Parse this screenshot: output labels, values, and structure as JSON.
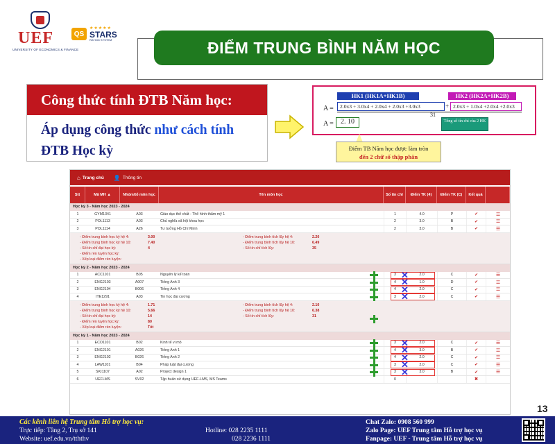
{
  "header": {
    "logo_text": "UEF",
    "logo_subtitle": "UNIVERSITY OF ECONOMICS & FINANCE",
    "qs_badge": "QS",
    "qs_stars_label": "STARS",
    "qs_subtitle": "RATING SYSTEM",
    "title": "ĐIỂM TRUNG BÌNH NĂM HỌC"
  },
  "formula_box": {
    "heading": "Công thức tính ĐTB Năm học:",
    "body_part1": "Áp dụng công thức ",
    "body_part2": "như cách tính",
    "body_part3": "ĐTB Học kỳ"
  },
  "formula_image": {
    "hk1_label": "HK1 (HK1A+HK1B)",
    "hk2_label": "HK2 (HK2A+HK2B)",
    "a_equals": "A =",
    "numerator_hk1": "2.0x3 + 3.0x4 + 2.0x4 + 2.0x3 +3.0x3",
    "plus": "+",
    "numerator_hk2": "2.0x3 + 1.0x4 +2.0x4 +2.0x3",
    "denominator": "31",
    "a_result_prefix": "A =",
    "result": "2. 10",
    "credits_note": "Tổng số tín chỉ của 2 HK",
    "rounding_note": "Điểm TB Năm học được làm tròn",
    "rounding_note_red": "đến 2 chữ số thập phân"
  },
  "screenshot": {
    "nav_tabs": [
      {
        "label": "Trang chủ",
        "icon": "home-icon"
      },
      {
        "label": "Thông tin",
        "icon": "user-icon"
      }
    ],
    "columns": [
      "Stt",
      "Mã MH ▲",
      "Nhóm/tổ môn học",
      "Tên môn học",
      "Số tín chỉ",
      "Điểm TK (4)",
      "Điểm TK (C)",
      "Kết quả",
      ""
    ],
    "sections": [
      {
        "title": "Học kỳ 3 - Năm học 2023 - 2024",
        "rows": [
          {
            "stt": "1",
            "code": "GYM1341",
            "group": "A03",
            "name": "Giáo dục thể chất - Thể hình thẩm mỹ 1",
            "credits": "1",
            "gpa4": "4.0",
            "grade": "P",
            "result": "✔",
            "more": "☰"
          },
          {
            "stt": "2",
            "code": "POL1113",
            "group": "A03",
            "name": "Chủ nghĩa xã hội khoa học",
            "credits": "2",
            "gpa4": "3.0",
            "grade": "B",
            "result": "✔",
            "more": "☰"
          },
          {
            "stt": "3",
            "code": "POL1114",
            "group": "A26",
            "name": "Tư tưởng Hồ Chí Minh",
            "credits": "2",
            "gpa4": "3.0",
            "grade": "B",
            "result": "✔",
            "more": "☰"
          }
        ],
        "summary": {
          "left": [
            {
              "label": "- Điểm trung bình học kỳ hệ 4:",
              "value": "3.00"
            },
            {
              "label": "- Điểm trung bình học kỳ hệ 10:",
              "value": "7.40"
            },
            {
              "label": "- Số tín chỉ đạt học kỳ:",
              "value": "4"
            },
            {
              "label": "- Điểm rèn luyện học kỳ:",
              "value": ""
            },
            {
              "label": "- Xếp loại điểm rèn luyện:",
              "value": ""
            }
          ],
          "right": [
            {
              "label": "- Điểm trung bình tích lũy hệ 4:",
              "value": "2.20"
            },
            {
              "label": "- Điểm trung bình tích lũy hệ 10:",
              "value": "6.49"
            },
            {
              "label": "- Số tín chỉ tích lũy:",
              "value": "35"
            }
          ]
        }
      },
      {
        "title": "Học kỳ 2 - Năm học 2023 - 2024",
        "rows": [
          {
            "stt": "1",
            "code": "ACC1101",
            "group": "B05",
            "name": "Nguyên lý kế toán",
            "credits": "3",
            "gpa4": "2.0",
            "grade": "C",
            "result": "✔",
            "more": "☰"
          },
          {
            "stt": "2",
            "code": "ENG2103",
            "group": "A007",
            "name": "Tiếng Anh 3",
            "credits": "4",
            "gpa4": "1.0",
            "grade": "D",
            "result": "✔",
            "more": "☰"
          },
          {
            "stt": "3",
            "code": "ENG2104",
            "group": "B006",
            "name": "Tiếng Anh 4",
            "credits": "4",
            "gpa4": "2.0",
            "grade": "C",
            "result": "✔",
            "more": "☰"
          },
          {
            "stt": "4",
            "code": "ITE1291",
            "group": "A03",
            "name": "Tin học đại cương",
            "credits": "3",
            "gpa4": "2.0",
            "grade": "C",
            "result": "✔",
            "more": "☰"
          }
        ],
        "summary": {
          "left": [
            {
              "label": "- Điểm trung bình học kỳ hệ 4:",
              "value": "1.71"
            },
            {
              "label": "- Điểm trung bình học kỳ hệ 10:",
              "value": "5.66"
            },
            {
              "label": "- Số tín chỉ đạt học kỳ:",
              "value": "14"
            },
            {
              "label": "- Điểm rèn luyện học kỳ:",
              "value": "80"
            },
            {
              "label": "- Xếp loại điểm rèn luyện:",
              "value": "Tốt"
            }
          ],
          "right": [
            {
              "label": "- Điểm trung bình tích lũy hệ 4:",
              "value": "2.10"
            },
            {
              "label": "- Điểm trung bình tích lũy hệ 10:",
              "value": "6.38"
            },
            {
              "label": "- Số tín chỉ tích lũy:",
              "value": "31"
            }
          ]
        }
      },
      {
        "title": "Học kỳ 1 - Năm học 2023 - 2024",
        "rows": [
          {
            "stt": "1",
            "code": "ECO1101",
            "group": "B02",
            "name": "Kinh tế vi mô",
            "credits": "3",
            "gpa4": "2.0",
            "grade": "C",
            "result": "✔",
            "more": "☰"
          },
          {
            "stt": "2",
            "code": "ENG2101",
            "group": "A026",
            "name": "Tiếng Anh 1",
            "credits": "4",
            "gpa4": "3.0",
            "grade": "B",
            "result": "✔",
            "more": "☰"
          },
          {
            "stt": "3",
            "code": "ENG2102",
            "group": "B026",
            "name": "Tiếng Anh 2",
            "credits": "4",
            "gpa4": "2.0",
            "grade": "C",
            "result": "✔",
            "more": "☰"
          },
          {
            "stt": "4",
            "code": "LAW1101",
            "group": "B04",
            "name": "Pháp luật đại cương",
            "credits": "3",
            "gpa4": "2.0",
            "grade": "C",
            "result": "✔",
            "more": "☰"
          },
          {
            "stt": "5",
            "code": "SKI1107",
            "group": "A02",
            "name": "Project design 1",
            "credits": "3",
            "gpa4": "3.0",
            "grade": "B",
            "result": "✔",
            "more": "☰"
          },
          {
            "stt": "6",
            "code": "UEFLMS",
            "group": "SV02",
            "name": "Tập huấn sử dụng UEF-LMS, MS Teams",
            "credits": "0",
            "gpa4": "",
            "grade": "",
            "result": "✖",
            "more": ""
          }
        ]
      }
    ]
  },
  "footer": {
    "heading": "Các kênh liên hệ Trung tâm Hỗ trợ học vụ:",
    "direct": "Trực tiếp: Tầng 2, Trụ sở 141",
    "website": "Website:   uef.edu.vn/tththv",
    "hotline1": "Hotline: 028 2235 1111",
    "hotline2": "028 2236 1111",
    "chat": "Chat Zalo: 0908 560 999",
    "zalo": "Zalo Page:  UEF Trung tâm Hỗ trợ học vụ",
    "fanpage": "Fanpage:    UEF - Trung tâm Hỗ trợ học vụ"
  },
  "page_number": "13",
  "colors": {
    "brand_red": "#c0161e",
    "title_green": "#1f7a1f",
    "footer_navy": "#1a237e",
    "highlight_blue": "#1e4fd8"
  }
}
